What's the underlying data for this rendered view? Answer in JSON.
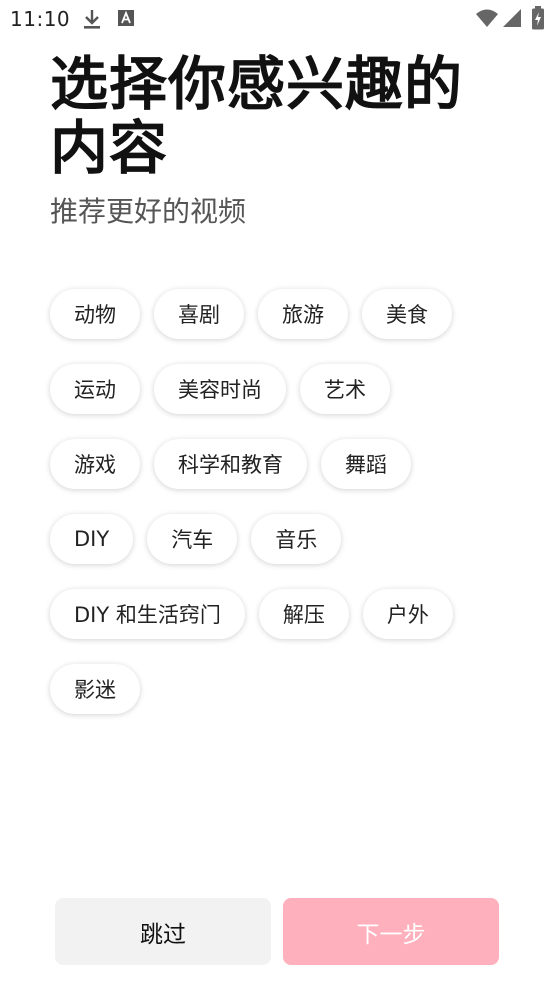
{
  "status_bar": {
    "time": "11:10",
    "icons": [
      "download-icon",
      "font-icon",
      "wifi-icon",
      "signal-icon",
      "battery-icon"
    ]
  },
  "header": {
    "title": "选择你感兴趣的内容",
    "subtitle": "推荐更好的视频"
  },
  "interests": {
    "rows": [
      [
        "动物",
        "喜剧",
        "旅游",
        "美食"
      ],
      [
        "运动",
        "美容时尚",
        "艺术"
      ],
      [
        "游戏",
        "科学和教育",
        "舞蹈"
      ],
      [
        "DIY",
        "汽车",
        "音乐"
      ],
      [
        "DIY 和生活窍门",
        "解压",
        "户外"
      ],
      [
        "影迷"
      ]
    ]
  },
  "actions": {
    "skip_label": "跳过",
    "next_label": "下一步"
  },
  "colors": {
    "next_button_bg": "#ffb0bd",
    "skip_button_bg": "#f2f2f2",
    "chip_bg": "#ffffff"
  }
}
